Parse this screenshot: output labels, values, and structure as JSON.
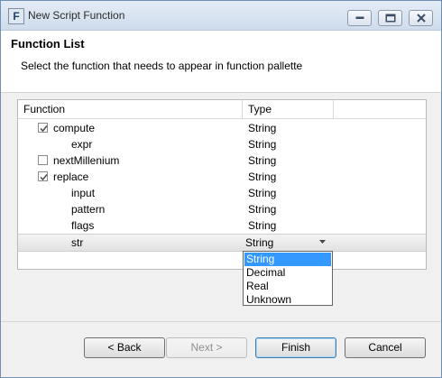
{
  "window": {
    "title": "New Script Function",
    "app_icon_letter": "F"
  },
  "header": {
    "title": "Function List",
    "description": "Select the function that needs to appear in function pallette"
  },
  "table": {
    "columns": [
      "Function",
      "Type"
    ],
    "rows": [
      {
        "name": "compute",
        "type": "String",
        "level": 0,
        "checkbox": true,
        "checked": true
      },
      {
        "name": "expr",
        "type": "String",
        "level": 1,
        "checkbox": false
      },
      {
        "name": "nextMillenium",
        "type": "String",
        "level": 0,
        "checkbox": true,
        "checked": false
      },
      {
        "name": "replace",
        "type": "String",
        "level": 0,
        "checkbox": true,
        "checked": true
      },
      {
        "name": "input",
        "type": "String",
        "level": 1,
        "checkbox": false
      },
      {
        "name": "pattern",
        "type": "String",
        "level": 1,
        "checkbox": false
      },
      {
        "name": "flags",
        "type": "String",
        "level": 1,
        "checkbox": false
      },
      {
        "name": "str",
        "type": "String",
        "level": 1,
        "checkbox": false,
        "selected": true,
        "editing": true
      }
    ]
  },
  "type_dropdown": {
    "options": [
      "String",
      "Decimal",
      "Real",
      "Unknown"
    ],
    "highlighted": "String"
  },
  "buttons": {
    "back": "< Back",
    "next": "Next >",
    "finish": "Finish",
    "cancel": "Cancel"
  }
}
